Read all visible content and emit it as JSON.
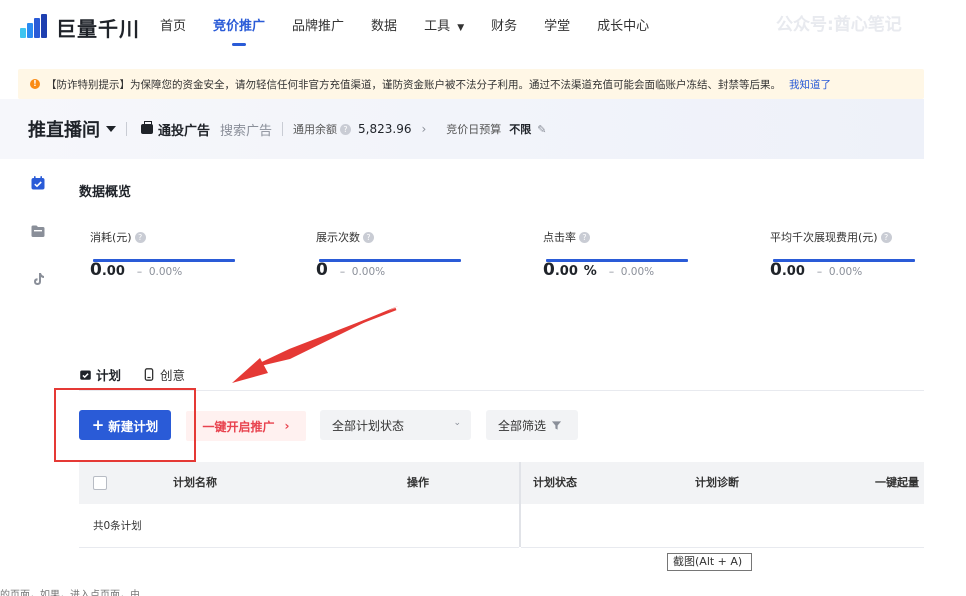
{
  "nav": {
    "logo_text": "巨量千川",
    "items": [
      {
        "label": "首页",
        "active": false
      },
      {
        "label": "竞价推广",
        "active": true
      },
      {
        "label": "品牌推广",
        "active": false
      },
      {
        "label": "数据",
        "active": false
      },
      {
        "label": "工具",
        "active": false,
        "dropdown": true
      },
      {
        "label": "财务",
        "active": false
      },
      {
        "label": "学堂",
        "active": false
      },
      {
        "label": "成长中心",
        "active": false
      }
    ],
    "watermark": "公众号:酋心笔记"
  },
  "notice": {
    "text": "【防诈特别提示】为保障您的资金安全，请勿轻信任何非官方充值渠道，谨防资金账户被不法分子利用。通过不法渠道充值可能会面临账户冻结、封禁等后果。",
    "link": "我知道了"
  },
  "header": {
    "mode_title": "推直播间",
    "ad_type": "通投广告",
    "ad_type_2": "搜索广告",
    "balance_label": "通用余额",
    "balance_value": "5,823.96",
    "budget_label": "竞价日预算",
    "budget_value": "不限"
  },
  "overview": {
    "title": "数据概览",
    "metrics": [
      {
        "label": "消耗(元)",
        "value": "0",
        "decimals": ".00",
        "unit": "",
        "trend": "0.00%"
      },
      {
        "label": "展示次数",
        "value": "0",
        "decimals": "",
        "unit": "",
        "trend": "0.00%"
      },
      {
        "label": "点击率",
        "value": "0",
        "decimals": ".00",
        "unit": "%",
        "trend": "0.00%"
      },
      {
        "label": "平均千次展现费用(元)",
        "value": "0",
        "decimals": ".00",
        "unit": "",
        "trend": "0.00%"
      }
    ]
  },
  "tabs": [
    {
      "label": "计划",
      "active": true
    },
    {
      "label": "创意",
      "active": false
    }
  ],
  "toolbar": {
    "new_plan": "新建计划",
    "launch": "一键开启推广",
    "status_select": "全部计划状态",
    "filter": "全部筛选"
  },
  "table": {
    "columns": [
      "计划名称",
      "操作",
      "计划状态",
      "计划诊断",
      "一键起量"
    ],
    "summary": "共0条计划"
  },
  "tooltip": "截图(Alt + A)",
  "bottom_ghost": "的页面，如果，进入点页面，由",
  "colors": {
    "primary": "#2a5bd7",
    "launch_red": "#e8424e",
    "notice_bg": "#fff7e6",
    "annotation_red": "#e53935"
  }
}
